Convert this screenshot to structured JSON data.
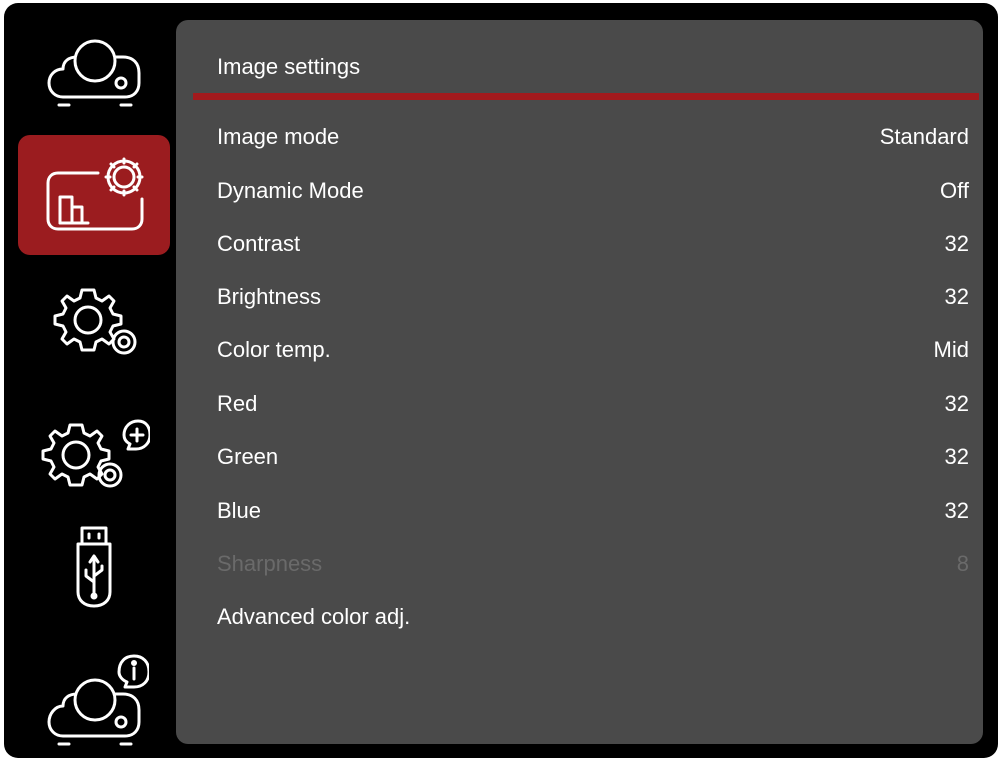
{
  "sidebar": {
    "items": [
      {
        "name": "projector",
        "icon": "projector-icon",
        "active": false
      },
      {
        "name": "image-settings",
        "icon": "image-settings-icon",
        "active": true
      },
      {
        "name": "basic-settings",
        "icon": "gear-icon",
        "active": false
      },
      {
        "name": "advanced-settings",
        "icon": "gear-plus-icon",
        "active": false
      },
      {
        "name": "usb",
        "icon": "usb-icon",
        "active": false
      },
      {
        "name": "information",
        "icon": "projector-info-icon",
        "active": false
      }
    ]
  },
  "panel": {
    "title": "Image settings",
    "rows": [
      {
        "label": "Image mode",
        "value": "Standard",
        "enabled": true
      },
      {
        "label": "Dynamic Mode",
        "value": "Off",
        "enabled": true
      },
      {
        "label": "Contrast",
        "value": "32",
        "enabled": true
      },
      {
        "label": "Brightness",
        "value": "32",
        "enabled": true
      },
      {
        "label": "Color temp.",
        "value": "Mid",
        "enabled": true
      },
      {
        "label": "Red",
        "value": "32",
        "enabled": true
      },
      {
        "label": "Green",
        "value": "32",
        "enabled": true
      },
      {
        "label": "Blue",
        "value": "32",
        "enabled": true
      },
      {
        "label": "Sharpness",
        "value": "8",
        "enabled": false
      },
      {
        "label": "Advanced color adj.",
        "value": "",
        "enabled": true
      }
    ]
  },
  "colors": {
    "accent": "#9b1c1f",
    "panel_bg": "#4a4a4a",
    "screen_bg": "#000000",
    "text": "#ffffff",
    "text_disabled": "#6a6a6a"
  }
}
